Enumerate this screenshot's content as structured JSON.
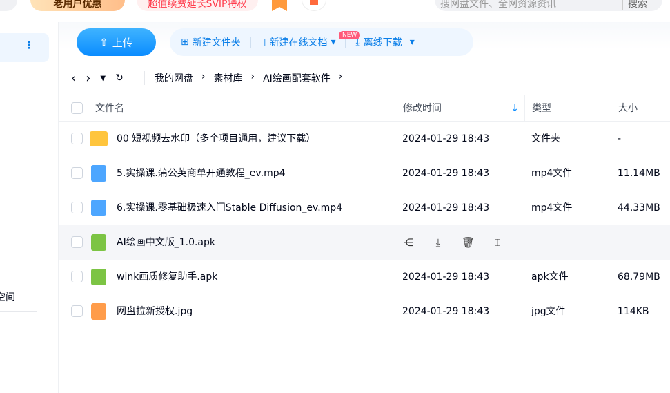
{
  "topbar": {
    "promo1": "老用户优惠",
    "promo2": "超值续费延长SVIP特权",
    "search_placeholder": "搜网盘文件、全网资源资讯",
    "search_button": "搜索"
  },
  "sidebar": {
    "partial_item": "空间"
  },
  "toolbar": {
    "upload": "上传",
    "new_folder": "新建文件夹",
    "new_doc": "新建在线文档",
    "new_badge": "NEW",
    "offline": "离线下载"
  },
  "breadcrumb": [
    "我的网盘",
    "素材库",
    "AI绘画配套软件"
  ],
  "columns": {
    "name": "文件名",
    "modified": "修改时间",
    "type": "类型",
    "size": "大小"
  },
  "files": [
    {
      "name": "00 短视频去水印（多个项目通用，建议下载）",
      "modified": "2024-01-29 18:43",
      "type": "文件夹",
      "size": "-",
      "icon": "folder"
    },
    {
      "name": "5.实操课.蒲公英商单开通教程_ev.mp4",
      "modified": "2024-01-29 18:43",
      "type": "mp4文件",
      "size": "11.14MB",
      "icon": "video"
    },
    {
      "name": "6.实操课.零基础极速入门Stable Diffusion_ev.mp4",
      "modified": "2024-01-29 18:43",
      "type": "mp4文件",
      "size": "44.33MB",
      "icon": "video"
    },
    {
      "name": "AI绘画中文版_1.0.apk",
      "modified": "",
      "type": "",
      "size": "",
      "icon": "apk"
    },
    {
      "name": "wink画质修复助手.apk",
      "modified": "2024-01-29 18:43",
      "type": "apk文件",
      "size": "68.79MB",
      "icon": "apk"
    },
    {
      "name": "网盘拉新授权.jpg",
      "modified": "2024-01-29 18:43",
      "type": "jpg文件",
      "size": "114KB",
      "icon": "image"
    }
  ]
}
